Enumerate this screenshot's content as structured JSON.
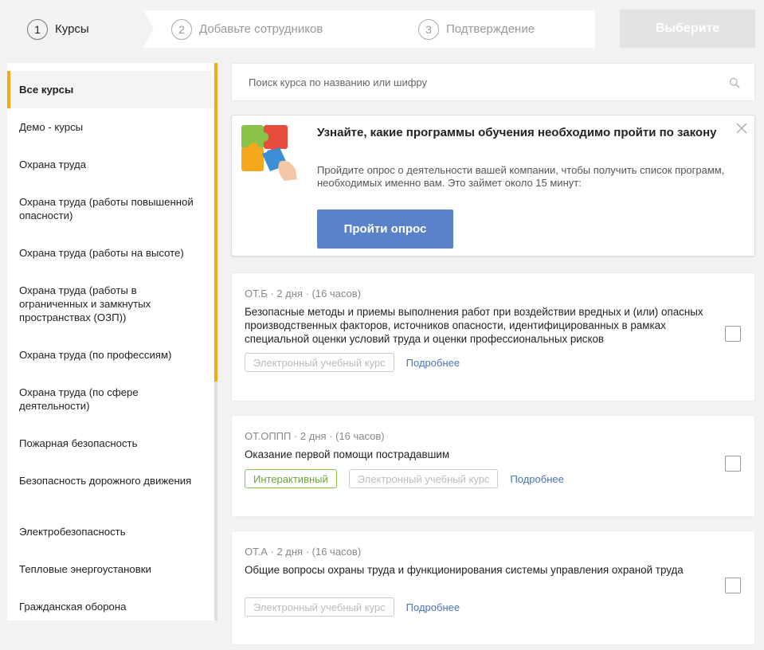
{
  "stepper": {
    "steps": [
      {
        "num": "1",
        "label": "Курсы"
      },
      {
        "num": "2",
        "label": "Добавьте сотрудников"
      },
      {
        "num": "3",
        "label": "Подтверждение"
      }
    ],
    "choose_label": "Выберите"
  },
  "sidebar": {
    "items": [
      {
        "label": "Все курсы"
      },
      {
        "label": "Демо - курсы"
      },
      {
        "label": "Охрана труда"
      },
      {
        "label": "Охрана труда (работы повышенной опасности)"
      },
      {
        "label": "Охрана труда (работы на высоте)"
      },
      {
        "label": "Охрана труда (работы в ограниченных и замкнутых пространствах (ОЗП))"
      },
      {
        "label": "Охрана труда (по профессиям)"
      },
      {
        "label": "Охрана труда (по сфере деятельности)"
      },
      {
        "label": "Пожарная безопасность"
      },
      {
        "label": "Безопасность дорожного движения"
      },
      {
        "label": "Электробезопасность"
      },
      {
        "label": "Тепловые энергоустановки"
      },
      {
        "label": "Гражданская оборона"
      }
    ]
  },
  "search": {
    "placeholder": "Поиск курса по названию или шифру",
    "value": ""
  },
  "promo": {
    "title": "Узнайте, какие программы обучения необходимо пройти по закону",
    "text": "Пройдите опрос о деятельности вашей компании, чтобы получить список программ, необходимых именно вам. Это займет около 15 минут:",
    "button_label": "Пройти опрос"
  },
  "courses": [
    {
      "meta": "ОТ.Б · 2 дня · (16 часов)",
      "title": "Безопасные методы и приемы выполнения работ при воздействии вредных и (или) опасных производственных факторов, источников опасности, идентифицированных в рамках специальной оценки условий труда и оценки профессиональных рисков",
      "tags": [
        "Электронный учебный курс"
      ],
      "more": "Подробнее"
    },
    {
      "meta": "ОТ.ОППП · 2 дня · (16 часов)",
      "title": "Оказание первой помощи пострадавшим",
      "tags": [
        "Интерактивный",
        "Электронный учебный курс"
      ],
      "more": "Подробнее"
    },
    {
      "meta": "ОТ.А · 2 дня · (16 часов)",
      "title": "Общие вопросы охраны труда и функционирования системы управления охраной труда",
      "tags": [
        "Электронный учебный курс"
      ],
      "more": "Подробнее"
    }
  ],
  "colors": {
    "accent": "#f5a81c",
    "primary_button": "#5b82c9",
    "link": "#4a74b8",
    "interactive_tag": "#6aa533"
  },
  "icons": {
    "search": "search-icon",
    "close": "close-icon",
    "promo": "puzzle-icon"
  }
}
